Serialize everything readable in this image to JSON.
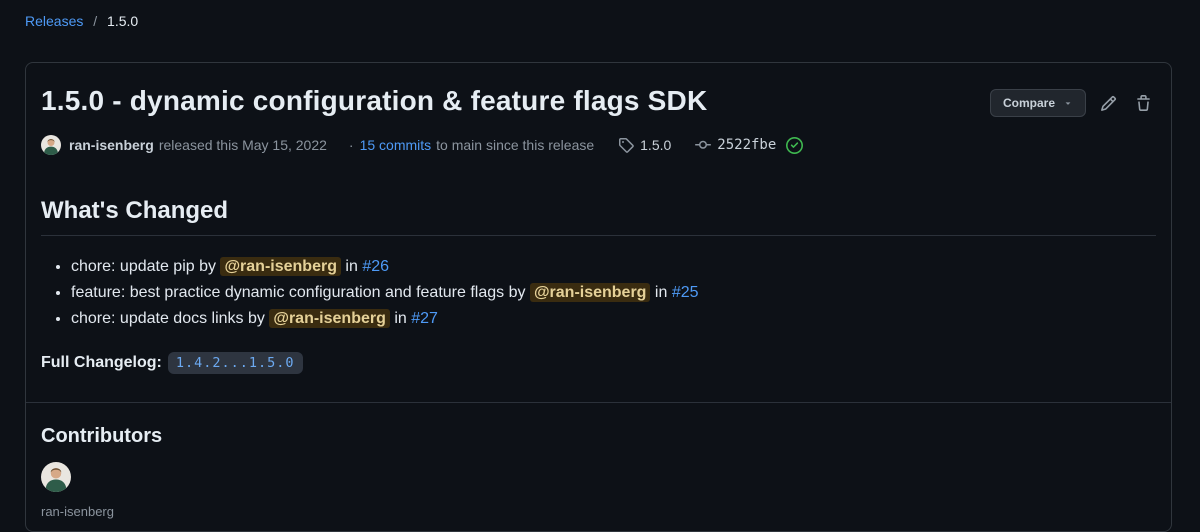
{
  "colors": {
    "page_bg": "#0d1117",
    "card_border": "#30363d",
    "link_blue": "#4e9af6",
    "mention_bg": "#3a2c10",
    "mention_text": "#e5d198",
    "verified_green": "#3fb950",
    "muted_text": "#8b949e",
    "button_bg": "#21262d"
  },
  "breadcrumb": {
    "releases_label": "Releases",
    "separator": "/",
    "current": "1.5.0"
  },
  "release": {
    "title": "1.5.0 - dynamic configuration & feature flags SDK",
    "actions": {
      "compare_label": "Compare"
    },
    "byline": {
      "author": "ran-isenberg",
      "released_text": "released this May 15, 2022",
      "dot": "·",
      "commits_link": "15 commits",
      "commits_suffix": "to main since this release",
      "tag_label": "1.5.0",
      "commit_sha": "2522fbe"
    },
    "whats_changed": {
      "heading": "What's Changed",
      "items": [
        {
          "text": "chore: update pip by",
          "mention": "@ran-isenberg",
          "conn": "in",
          "pr": "#26"
        },
        {
          "text": "feature: best practice dynamic configuration and feature flags by",
          "mention": "@ran-isenberg",
          "conn": "in",
          "pr": "#25"
        },
        {
          "text": "chore: update docs links by",
          "mention": "@ran-isenberg",
          "conn": "in",
          "pr": "#27"
        }
      ]
    },
    "changelog": {
      "label": "Full Changelog:",
      "range": "1.4.2...1.5.0"
    },
    "contributors": {
      "heading": "Contributors",
      "contributor_name": "ran-isenberg"
    }
  }
}
